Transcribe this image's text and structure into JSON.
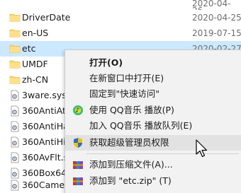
{
  "header": {
    "partial_date": "2020-04-26"
  },
  "files": [
    {
      "name": "DriverDate",
      "date": "2020-04-25",
      "type": "folder",
      "icon": "folder-icon"
    },
    {
      "name": "en-US",
      "date": "2019-07-15",
      "type": "folder",
      "icon": "folder-icon"
    },
    {
      "name": "etc",
      "date": "2020-02-27",
      "type": "folder",
      "icon": "folder-icon",
      "selected": true
    },
    {
      "name": "UMDF",
      "date": "",
      "type": "folder",
      "icon": "folder-icon"
    },
    {
      "name": "zh-CN",
      "date": "",
      "type": "folder",
      "icon": "folder-icon"
    },
    {
      "name": "3ware.sys",
      "date": "",
      "type": "file",
      "icon": "system-file-icon"
    },
    {
      "name": "360AntiAtt",
      "date": "",
      "type": "file",
      "icon": "system-file-icon"
    },
    {
      "name": "360AntiHa",
      "date": "",
      "type": "file",
      "icon": "system-file-icon"
    },
    {
      "name": "360AntiHij",
      "date": "",
      "type": "file",
      "icon": "system-file-icon"
    },
    {
      "name": "360AvFlt.sy",
      "date": "",
      "type": "file",
      "icon": "system-file-icon"
    },
    {
      "name": "360Box64.",
      "date": "",
      "type": "file",
      "icon": "system-file-icon"
    },
    {
      "name": "360Camer",
      "date": "",
      "type": "file",
      "icon": "system-file-icon"
    }
  ],
  "context_menu": {
    "items": [
      {
        "label": "打开(O)",
        "bold": true,
        "icon": ""
      },
      {
        "label": "在新窗口中打开(E)",
        "bold": false,
        "icon": ""
      },
      {
        "label": "固定到\"快速访问\"",
        "bold": false,
        "icon": ""
      },
      {
        "label": "使用 QQ音乐 播放(P)",
        "bold": false,
        "icon": "qq-music-icon"
      },
      {
        "label": "加入 QQ音乐 播放队列(E)",
        "bold": false,
        "icon": ""
      },
      {
        "label": "获取超级管理员权限",
        "bold": false,
        "icon": "admin-shield-icon",
        "hover": true
      },
      {
        "label": "添加到压缩文件(A)...",
        "bold": false,
        "icon": "archive-icon"
      },
      {
        "label": "添加到 \"etc.zip\" (T)",
        "bold": false,
        "icon": "archive-icon"
      }
    ]
  },
  "colors": {
    "selection": "#cce8ff",
    "menu_bg": "#f2f2f2",
    "menu_hover": "#e2e2e2",
    "folder": "#f8d775"
  }
}
